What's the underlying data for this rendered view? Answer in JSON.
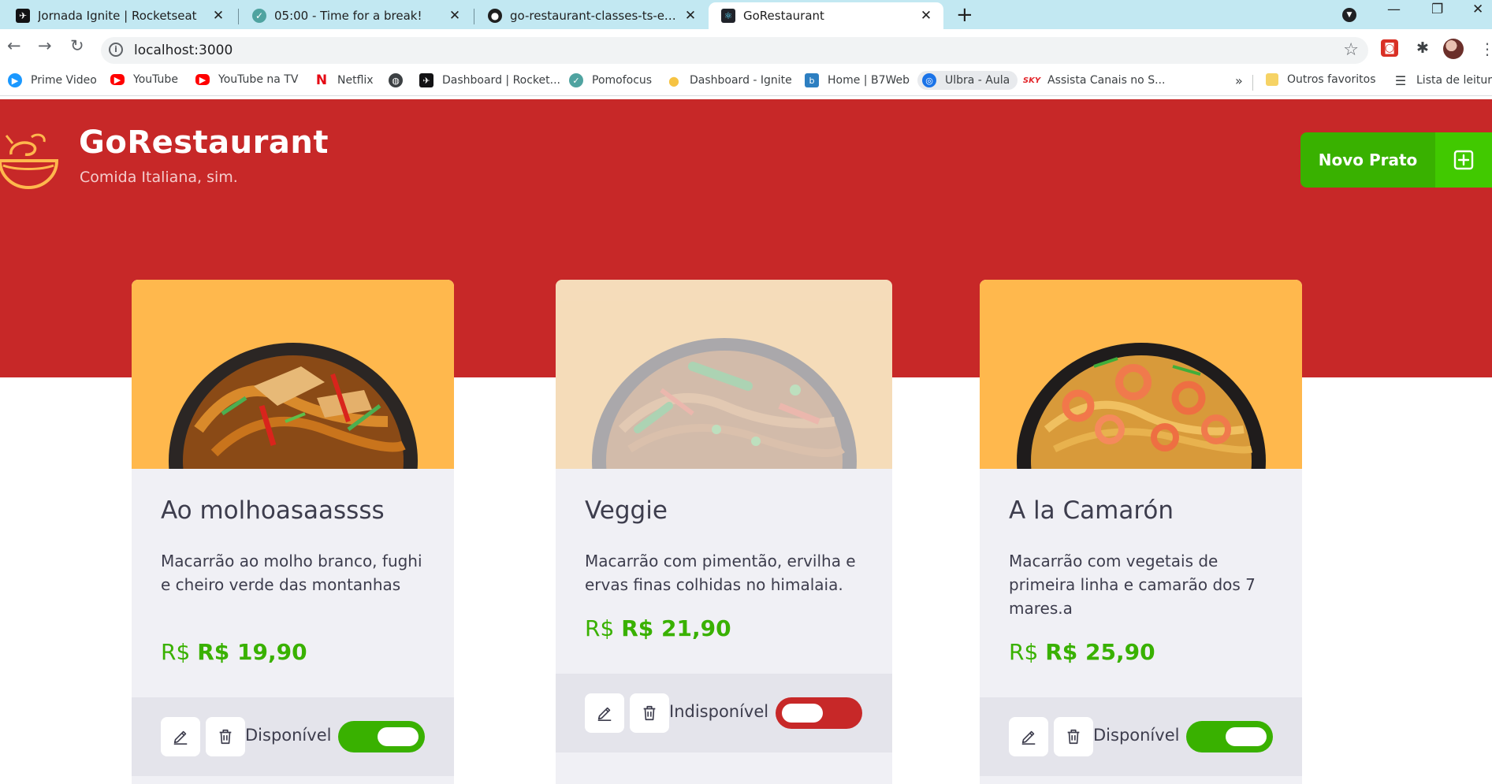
{
  "browser": {
    "tabs": [
      {
        "title": "Jornada Ignite | Rocketseat",
        "favicon": "rocketseat-icon"
      },
      {
        "title": "05:00 - Time for a break!",
        "favicon": "pomofocus-check-icon"
      },
      {
        "title": "go-restaurant-classes-ts-extra-challenge",
        "favicon": "github-icon"
      },
      {
        "title": "GoRestaurant",
        "favicon": "react-icon",
        "active": true
      }
    ],
    "url": "localhost:3000",
    "bookmarks": [
      {
        "label": "Prime Video",
        "icon": "prime-video-icon"
      },
      {
        "label": "YouTube",
        "icon": "youtube-icon"
      },
      {
        "label": "YouTube na TV",
        "icon": "youtube-icon"
      },
      {
        "label": "Netflix",
        "icon": "netflix-icon"
      },
      {
        "label": "",
        "icon": "globe-icon"
      },
      {
        "label": "Dashboard | Rocket...",
        "icon": "rocketseat-icon"
      },
      {
        "label": "Pomofocus",
        "icon": "pomofocus-check-icon"
      },
      {
        "label": "Dashboard - Ignite",
        "icon": "lightbulb-icon"
      },
      {
        "label": "Home | B7Web",
        "icon": "b7web-icon"
      },
      {
        "label": "Ulbra - Aula",
        "icon": "ulbra-icon"
      },
      {
        "label": "Assista Canais no S...",
        "icon": "sky-icon"
      }
    ],
    "overflow": "»",
    "other_bookmarks": "Outros favoritos",
    "reading_list": "Lista de leitura"
  },
  "header": {
    "brand": "GoRestaurant",
    "tagline": "Comida Italiana, sim.",
    "new_button": "Novo Prato"
  },
  "foods": [
    {
      "name": "Ao molhoasaassss",
      "description": "Macarrão ao molho branco, fughi e cheiro verde das montanhas",
      "currency": "R$",
      "price": "R$ 19,90",
      "status": "Disponível",
      "available": true
    },
    {
      "name": "Veggie",
      "description": "Macarrão com pimentão, ervilha e ervas finas colhidas no himalaia.",
      "currency": "R$",
      "price": "R$ 21,90",
      "status": "Indisponível",
      "available": false
    },
    {
      "name": "A la Camarón",
      "description": "Macarrão com vegetais de primeira linha e camarão dos 7 mares.a",
      "currency": "R$",
      "price": "R$ 25,90",
      "status": "Disponível",
      "available": true
    }
  ],
  "colors": {
    "header_red": "#c72828",
    "green": "#39b100",
    "card_bg": "#f0f0f5",
    "card_image_bg": "#ffb84d",
    "toggle_off": "#c72828"
  }
}
